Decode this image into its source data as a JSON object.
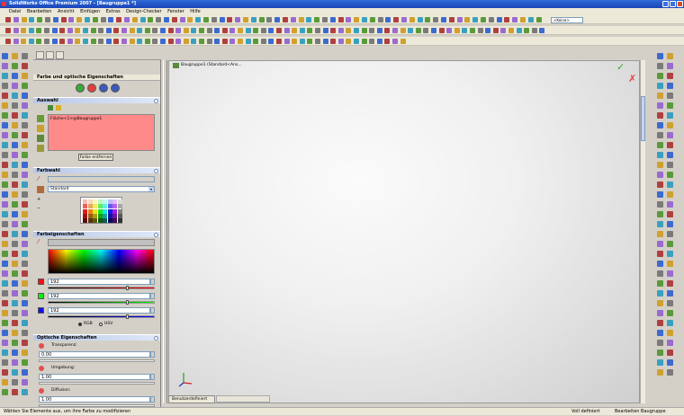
{
  "window": {
    "title": "SolidWorks Office Premium 2007 - [Baugruppe1 *]"
  },
  "menu": [
    "Datei",
    "Bearbeiten",
    "Ansicht",
    "Einfügen",
    "Extras",
    "Design-Checker",
    "Fenster",
    "Hilfe"
  ],
  "toolbar": {
    "search_placeholder": "<Keine>"
  },
  "panel": {
    "title": "Farbe und optische Eigenschaften",
    "selection": {
      "header": "Auswahl",
      "item": "Fläche<1>@Baugruppe1",
      "remove_button": "Farbe entfernen"
    },
    "color_style": {
      "header": "Farbwahl",
      "preset": "Standard"
    },
    "color_props": {
      "header": "Farbeigenschaften",
      "r_value": "192",
      "g_value": "192",
      "b_value": "192",
      "r_level": 0.75,
      "g_level": 0.75,
      "b_level": 0.75,
      "mode_rgb": "RGB",
      "mode_hsv": "HSV"
    },
    "optical": {
      "header": "Optische Eigenschaften",
      "transparency_label": "Transparenz:",
      "transparency_value": "0.00",
      "ambient_label": "Umgebung:",
      "ambient_value": "1.00",
      "diffuse_label": "Diffusion:",
      "diffuse_value": "1.00"
    }
  },
  "viewport": {
    "tree_item": "Baugruppe1 (Standard<Ans..."
  },
  "tab": {
    "label": "Benutzerdefiniert"
  },
  "status": {
    "hint": "Wählen Sie Elemente aus, um ihre Farbe zu modifizieren",
    "defined": "Voll definiert",
    "mode": "Bearbeiten Baugruppe"
  },
  "colors": {
    "selection_bg": "#ff8a8a",
    "accept": "#3aa83a",
    "cancel": "#e04040"
  }
}
